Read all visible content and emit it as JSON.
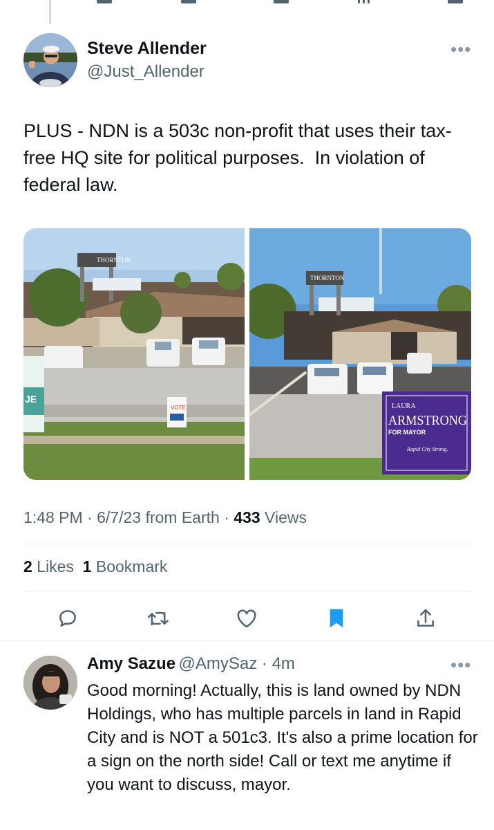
{
  "tweet": {
    "author": {
      "name": "Steve Allender",
      "handle": "@Just_Allender"
    },
    "text": "PLUS - NDN is a 503c non-profit that uses their tax-free HQ site for political purposes.  In violation of federal law.",
    "photos": {
      "left": {
        "sign_building": "THORNTON",
        "yard_sign": "VOTE"
      },
      "right": {
        "sign_building": "THORNTON",
        "campaign_sign": {
          "first_name": "LAURA",
          "last_name": "ARMSTRONG",
          "office": "FOR MAYOR",
          "slogan": "Rapid City Strong."
        }
      }
    },
    "meta": {
      "time": "1:48 PM",
      "sep1": " · ",
      "date": "6/7/23",
      "source": " from Earth",
      "sep2": " · ",
      "views_count": "433",
      "views_label": " Views"
    },
    "stats": {
      "likes_count": "2",
      "likes_label": " Likes",
      "bookmarks_count": "1",
      "bookmarks_label": " Bookmark"
    },
    "actions": {
      "reply": "reply-icon",
      "retweet": "retweet-icon",
      "like": "heart-icon",
      "bookmark": "bookmark-icon",
      "share": "share-icon"
    }
  },
  "reply": {
    "author": {
      "name": "Amy Sazue",
      "handle": "@AmySaz",
      "sep": " · ",
      "time": "4m"
    },
    "text": "Good morning! Actually, this is land owned by NDN Holdings, who has multiple parcels in land in Rapid City and is NOT a 501c3. It's also a prime location for a sign on the north side! Call or text me anytime if you want to discuss, mayor."
  },
  "colors": {
    "text_primary": "#0f1419",
    "text_secondary": "#536471",
    "accent": "#1d9bf0",
    "divider": "#eff3f4"
  }
}
